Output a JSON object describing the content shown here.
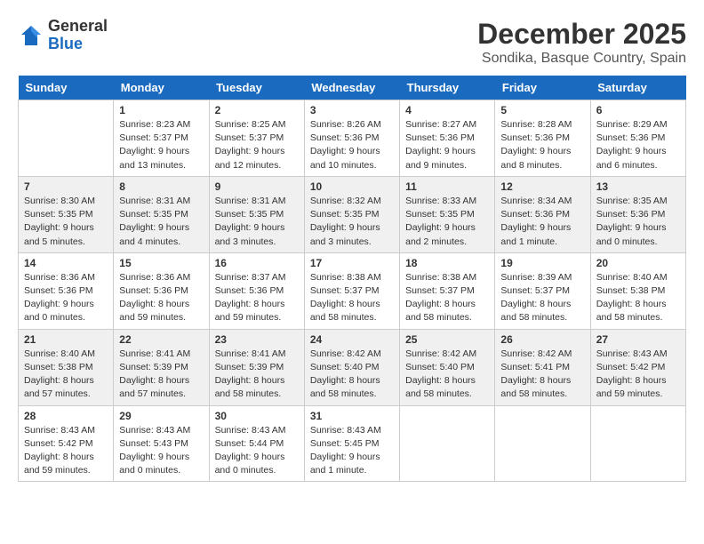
{
  "logo": {
    "general": "General",
    "blue": "Blue"
  },
  "title": "December 2025",
  "location": "Sondika, Basque Country, Spain",
  "days_of_week": [
    "Sunday",
    "Monday",
    "Tuesday",
    "Wednesday",
    "Thursday",
    "Friday",
    "Saturday"
  ],
  "weeks": [
    [
      {
        "day": "",
        "info": ""
      },
      {
        "day": "1",
        "info": "Sunrise: 8:23 AM\nSunset: 5:37 PM\nDaylight: 9 hours\nand 13 minutes."
      },
      {
        "day": "2",
        "info": "Sunrise: 8:25 AM\nSunset: 5:37 PM\nDaylight: 9 hours\nand 12 minutes."
      },
      {
        "day": "3",
        "info": "Sunrise: 8:26 AM\nSunset: 5:36 PM\nDaylight: 9 hours\nand 10 minutes."
      },
      {
        "day": "4",
        "info": "Sunrise: 8:27 AM\nSunset: 5:36 PM\nDaylight: 9 hours\nand 9 minutes."
      },
      {
        "day": "5",
        "info": "Sunrise: 8:28 AM\nSunset: 5:36 PM\nDaylight: 9 hours\nand 8 minutes."
      },
      {
        "day": "6",
        "info": "Sunrise: 8:29 AM\nSunset: 5:36 PM\nDaylight: 9 hours\nand 6 minutes."
      }
    ],
    [
      {
        "day": "7",
        "info": "Sunrise: 8:30 AM\nSunset: 5:35 PM\nDaylight: 9 hours\nand 5 minutes."
      },
      {
        "day": "8",
        "info": "Sunrise: 8:31 AM\nSunset: 5:35 PM\nDaylight: 9 hours\nand 4 minutes."
      },
      {
        "day": "9",
        "info": "Sunrise: 8:31 AM\nSunset: 5:35 PM\nDaylight: 9 hours\nand 3 minutes."
      },
      {
        "day": "10",
        "info": "Sunrise: 8:32 AM\nSunset: 5:35 PM\nDaylight: 9 hours\nand 3 minutes."
      },
      {
        "day": "11",
        "info": "Sunrise: 8:33 AM\nSunset: 5:35 PM\nDaylight: 9 hours\nand 2 minutes."
      },
      {
        "day": "12",
        "info": "Sunrise: 8:34 AM\nSunset: 5:36 PM\nDaylight: 9 hours\nand 1 minute."
      },
      {
        "day": "13",
        "info": "Sunrise: 8:35 AM\nSunset: 5:36 PM\nDaylight: 9 hours\nand 0 minutes."
      }
    ],
    [
      {
        "day": "14",
        "info": "Sunrise: 8:36 AM\nSunset: 5:36 PM\nDaylight: 9 hours\nand 0 minutes."
      },
      {
        "day": "15",
        "info": "Sunrise: 8:36 AM\nSunset: 5:36 PM\nDaylight: 8 hours\nand 59 minutes."
      },
      {
        "day": "16",
        "info": "Sunrise: 8:37 AM\nSunset: 5:36 PM\nDaylight: 8 hours\nand 59 minutes."
      },
      {
        "day": "17",
        "info": "Sunrise: 8:38 AM\nSunset: 5:37 PM\nDaylight: 8 hours\nand 58 minutes."
      },
      {
        "day": "18",
        "info": "Sunrise: 8:38 AM\nSunset: 5:37 PM\nDaylight: 8 hours\nand 58 minutes."
      },
      {
        "day": "19",
        "info": "Sunrise: 8:39 AM\nSunset: 5:37 PM\nDaylight: 8 hours\nand 58 minutes."
      },
      {
        "day": "20",
        "info": "Sunrise: 8:40 AM\nSunset: 5:38 PM\nDaylight: 8 hours\nand 58 minutes."
      }
    ],
    [
      {
        "day": "21",
        "info": "Sunrise: 8:40 AM\nSunset: 5:38 PM\nDaylight: 8 hours\nand 57 minutes."
      },
      {
        "day": "22",
        "info": "Sunrise: 8:41 AM\nSunset: 5:39 PM\nDaylight: 8 hours\nand 57 minutes."
      },
      {
        "day": "23",
        "info": "Sunrise: 8:41 AM\nSunset: 5:39 PM\nDaylight: 8 hours\nand 58 minutes."
      },
      {
        "day": "24",
        "info": "Sunrise: 8:42 AM\nSunset: 5:40 PM\nDaylight: 8 hours\nand 58 minutes."
      },
      {
        "day": "25",
        "info": "Sunrise: 8:42 AM\nSunset: 5:40 PM\nDaylight: 8 hours\nand 58 minutes."
      },
      {
        "day": "26",
        "info": "Sunrise: 8:42 AM\nSunset: 5:41 PM\nDaylight: 8 hours\nand 58 minutes."
      },
      {
        "day": "27",
        "info": "Sunrise: 8:43 AM\nSunset: 5:42 PM\nDaylight: 8 hours\nand 59 minutes."
      }
    ],
    [
      {
        "day": "28",
        "info": "Sunrise: 8:43 AM\nSunset: 5:42 PM\nDaylight: 8 hours\nand 59 minutes."
      },
      {
        "day": "29",
        "info": "Sunrise: 8:43 AM\nSunset: 5:43 PM\nDaylight: 9 hours\nand 0 minutes."
      },
      {
        "day": "30",
        "info": "Sunrise: 8:43 AM\nSunset: 5:44 PM\nDaylight: 9 hours\nand 0 minutes."
      },
      {
        "day": "31",
        "info": "Sunrise: 8:43 AM\nSunset: 5:45 PM\nDaylight: 9 hours\nand 1 minute."
      },
      {
        "day": "",
        "info": ""
      },
      {
        "day": "",
        "info": ""
      },
      {
        "day": "",
        "info": ""
      }
    ]
  ]
}
